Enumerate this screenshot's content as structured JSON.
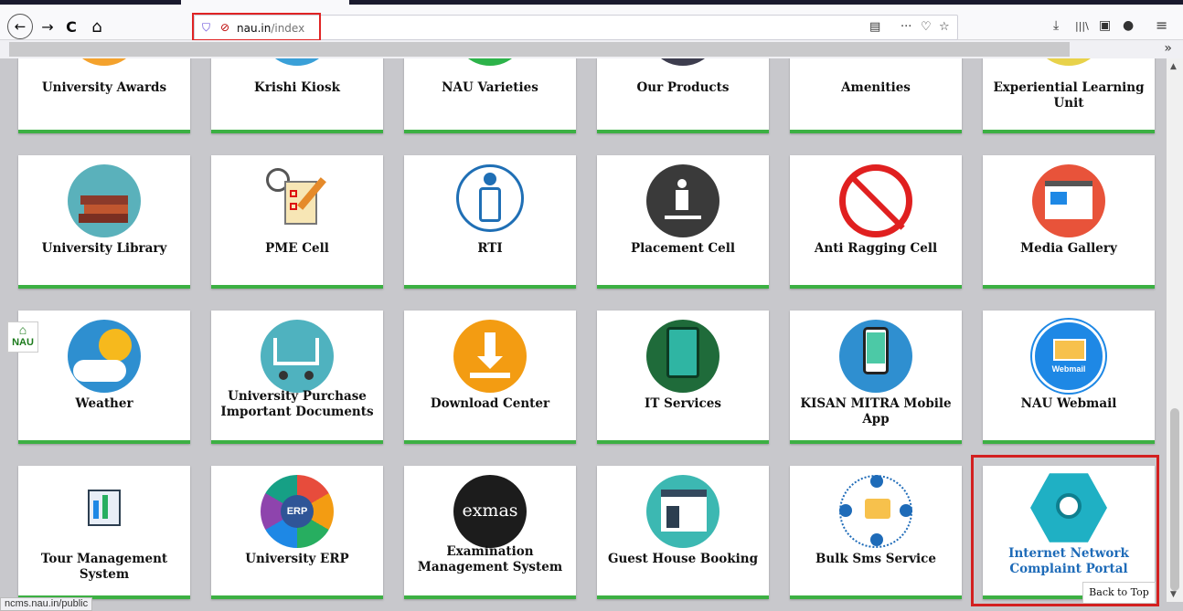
{
  "browser": {
    "url_domain": "nau.in",
    "url_path": "/index",
    "status_url": "ncms.nau.in/public"
  },
  "icons": {
    "back": "←",
    "forward": "→",
    "reload": "C",
    "home": "⌂",
    "reader": "▤",
    "more": "···",
    "pocket": "♡",
    "bookmark": "☆",
    "download": "⤓",
    "library": "|||\\",
    "sidebar": "▣",
    "account": "●",
    "menu": "≡",
    "overflow": "»"
  },
  "rows": [
    [
      {
        "label": "University Awards",
        "color": "#f4a22d"
      },
      {
        "label": "Krishi Kiosk",
        "color": "#3aa0d8"
      },
      {
        "label": "NAU Varieties",
        "color": "#2db34a"
      },
      {
        "label": "Our Products",
        "color": "#3d3d4e"
      },
      {
        "label": "Amenities",
        "color": "#5b9bd5"
      },
      {
        "label": "Experiential Learning Unit",
        "color": "#e8d24a"
      }
    ],
    [
      {
        "label": "University Library",
        "color": "#5ab1bb"
      },
      {
        "label": "PME Cell",
        "color": "#ffffff"
      },
      {
        "label": "RTI",
        "color": "#ffffff"
      },
      {
        "label": "Placement Cell",
        "color": "#3a3a3a"
      },
      {
        "label": "Anti Ragging Cell",
        "color": "#ffffff"
      },
      {
        "label": "Media Gallery",
        "color": "#e8533a"
      }
    ],
    [
      {
        "label": "Weather",
        "color": "#2e8fd0"
      },
      {
        "label": "University Purchase Important Documents",
        "color": "#4fb2bf"
      },
      {
        "label": "Download Center",
        "color": "#f39c12"
      },
      {
        "label": "IT Services",
        "color": "#1f6b3a"
      },
      {
        "label": "KISAN MITRA Mobile App",
        "color": "#2f8fd0"
      },
      {
        "label": "NAU Webmail",
        "color": "#1e88e5"
      }
    ],
    [
      {
        "label": "Tour Management System",
        "color": "#ffffff"
      },
      {
        "label": "University ERP",
        "color": "#2f5597"
      },
      {
        "label": "Examination Management System",
        "color": "#1c1c1c"
      },
      {
        "label": "Guest House Booking",
        "color": "#3cb8b2"
      },
      {
        "label": "Bulk Sms Service",
        "color": "#ffffff"
      },
      {
        "label": "Internet Network Complaint Portal",
        "color": "#1fb0c4"
      }
    ]
  ],
  "icon_text": {
    "anti_ragging": "ANTI RAGGING CELL",
    "exmas": "exmas",
    "webmail": "Webmail",
    "erp": "ERP"
  },
  "widgets": {
    "home_label": "NAU",
    "back_to_top": "Back to Top"
  }
}
